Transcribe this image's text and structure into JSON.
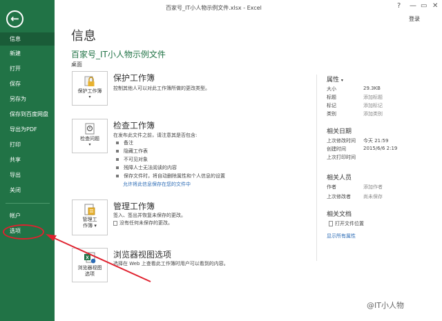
{
  "window": {
    "title": "百家号_IT小人物示例文件.xlsx - Excel",
    "help": "?",
    "minimize": "—",
    "restore": "▭",
    "close": "✕",
    "login": "登录"
  },
  "sidebar": {
    "items": [
      {
        "label": "信息",
        "active": true
      },
      {
        "label": "新建"
      },
      {
        "label": "打开"
      },
      {
        "label": "保存"
      },
      {
        "label": "另存为"
      },
      {
        "label": "保存到百度网盘"
      },
      {
        "label": "导出为PDF"
      },
      {
        "label": "打印"
      },
      {
        "label": "共享"
      },
      {
        "label": "导出"
      },
      {
        "label": "关闭"
      },
      {
        "label": "帐户"
      },
      {
        "label": "选项"
      }
    ]
  },
  "main": {
    "heading": "信息",
    "file_name": "百家号_IT小人物示例文件",
    "file_path": "桌面",
    "protect": {
      "button": "保护工作簿",
      "title": "保护工作簿",
      "desc": "控制其他人可以对此工作簿所做的更改类型。"
    },
    "inspect": {
      "button": "检查问题",
      "title": "检查工作簿",
      "desc": "在发布此文件之前，请注意其是否包含:",
      "bullets": [
        "备注",
        "隐藏工作表",
        "不可见对象",
        "残障人士无法阅读的内容",
        "保存文件时，将自动删除属性和个人信息的设置"
      ],
      "link": "允许将此信息保存在您的文件中"
    },
    "manage": {
      "button_line1": "管理工",
      "button_line2": "作簿",
      "title": "管理工作簿",
      "desc": "签入、签出并恢复未保存的更改。",
      "note": "没有任何未保存的更改。"
    },
    "browser": {
      "button_line1": "浏览器视图",
      "button_line2": "选项",
      "title": "浏览器视图选项",
      "desc": "选择在 Web 上查看此工作簿时用户可以看到的内容。"
    }
  },
  "properties": {
    "heading": "属性",
    "rows": [
      {
        "label": "大小",
        "value": "29.3KB",
        "muted": false
      },
      {
        "label": "标题",
        "value": "添加标题",
        "muted": true
      },
      {
        "label": "标记",
        "value": "添加标记",
        "muted": true
      },
      {
        "label": "类别",
        "value": "添加类别",
        "muted": true
      }
    ],
    "dates_heading": "相关日期",
    "dates": [
      {
        "label": "上次修改时间",
        "value": "今天 21:59"
      },
      {
        "label": "创建时间",
        "value": "2015/6/6 2:19"
      },
      {
        "label": "上次打印时间",
        "value": ""
      }
    ],
    "people_heading": "相关人员",
    "people": [
      {
        "label": "作者",
        "value": "添加作者"
      },
      {
        "label": "上次修改者",
        "value": "尚未保存"
      }
    ],
    "docs_heading": "相关文档",
    "open_location": "打开文件位置",
    "show_all": "显示所有属性"
  },
  "watermark": "@IT小人物",
  "colors": {
    "accent": "#217346",
    "annotation": "#e0212e",
    "link": "#2b6bb5"
  }
}
